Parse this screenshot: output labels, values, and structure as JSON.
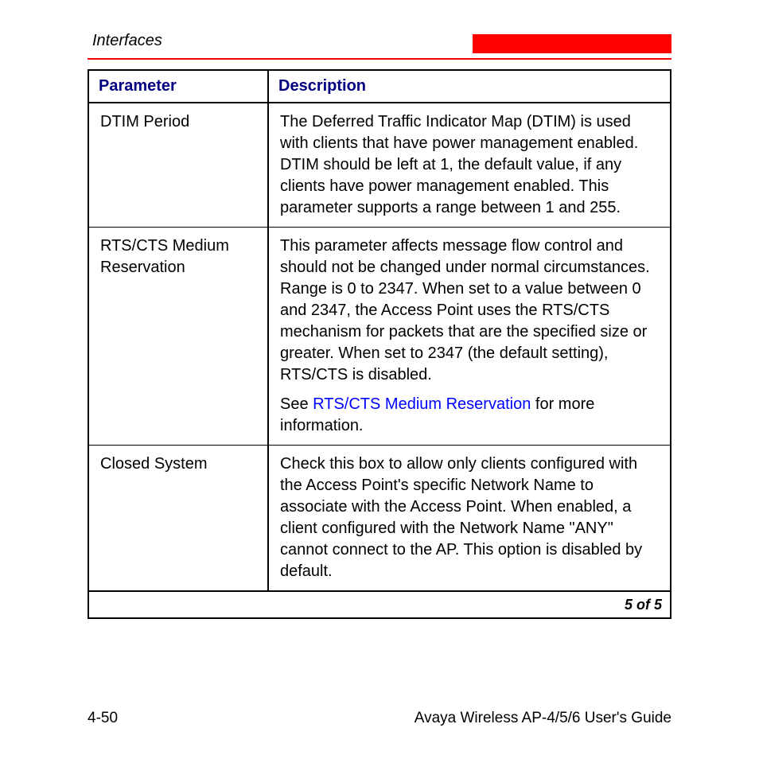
{
  "header": {
    "section": "Interfaces"
  },
  "table": {
    "col_parameter": "Parameter",
    "col_description": "Description",
    "rows": [
      {
        "param": "DTIM Period",
        "desc": "The Deferred Traffic Indicator Map (DTIM) is used with clients that have power management enabled. DTIM should be left at 1, the default value, if any clients have power management enabled. This parameter supports a range between 1 and 255."
      },
      {
        "param": "RTS/CTS Medium Reservation",
        "desc": "This parameter affects message flow control and should not be changed under normal circumstances. Range is 0 to 2347. When set to a value between 0 and 2347, the Access Point uses the RTS/CTS mechanism for packets that are the specified size or greater. When set to 2347 (the default setting), RTS/CTS is disabled.",
        "desc2_pre": "See ",
        "desc2_link": "RTS/CTS Medium Reservation",
        "desc2_post": " for more information."
      },
      {
        "param": "Closed System",
        "desc": "Check this box to allow only clients configured with the Access Point's specific Network Name to associate with the Access Point. When enabled, a client configured with the Network Name \"ANY\" cannot connect to the AP. This option is disabled by default."
      }
    ],
    "pager": "5 of 5"
  },
  "footer": {
    "page_number": "4-50",
    "doc_title": "Avaya Wireless AP-4/5/6 User's Guide"
  }
}
